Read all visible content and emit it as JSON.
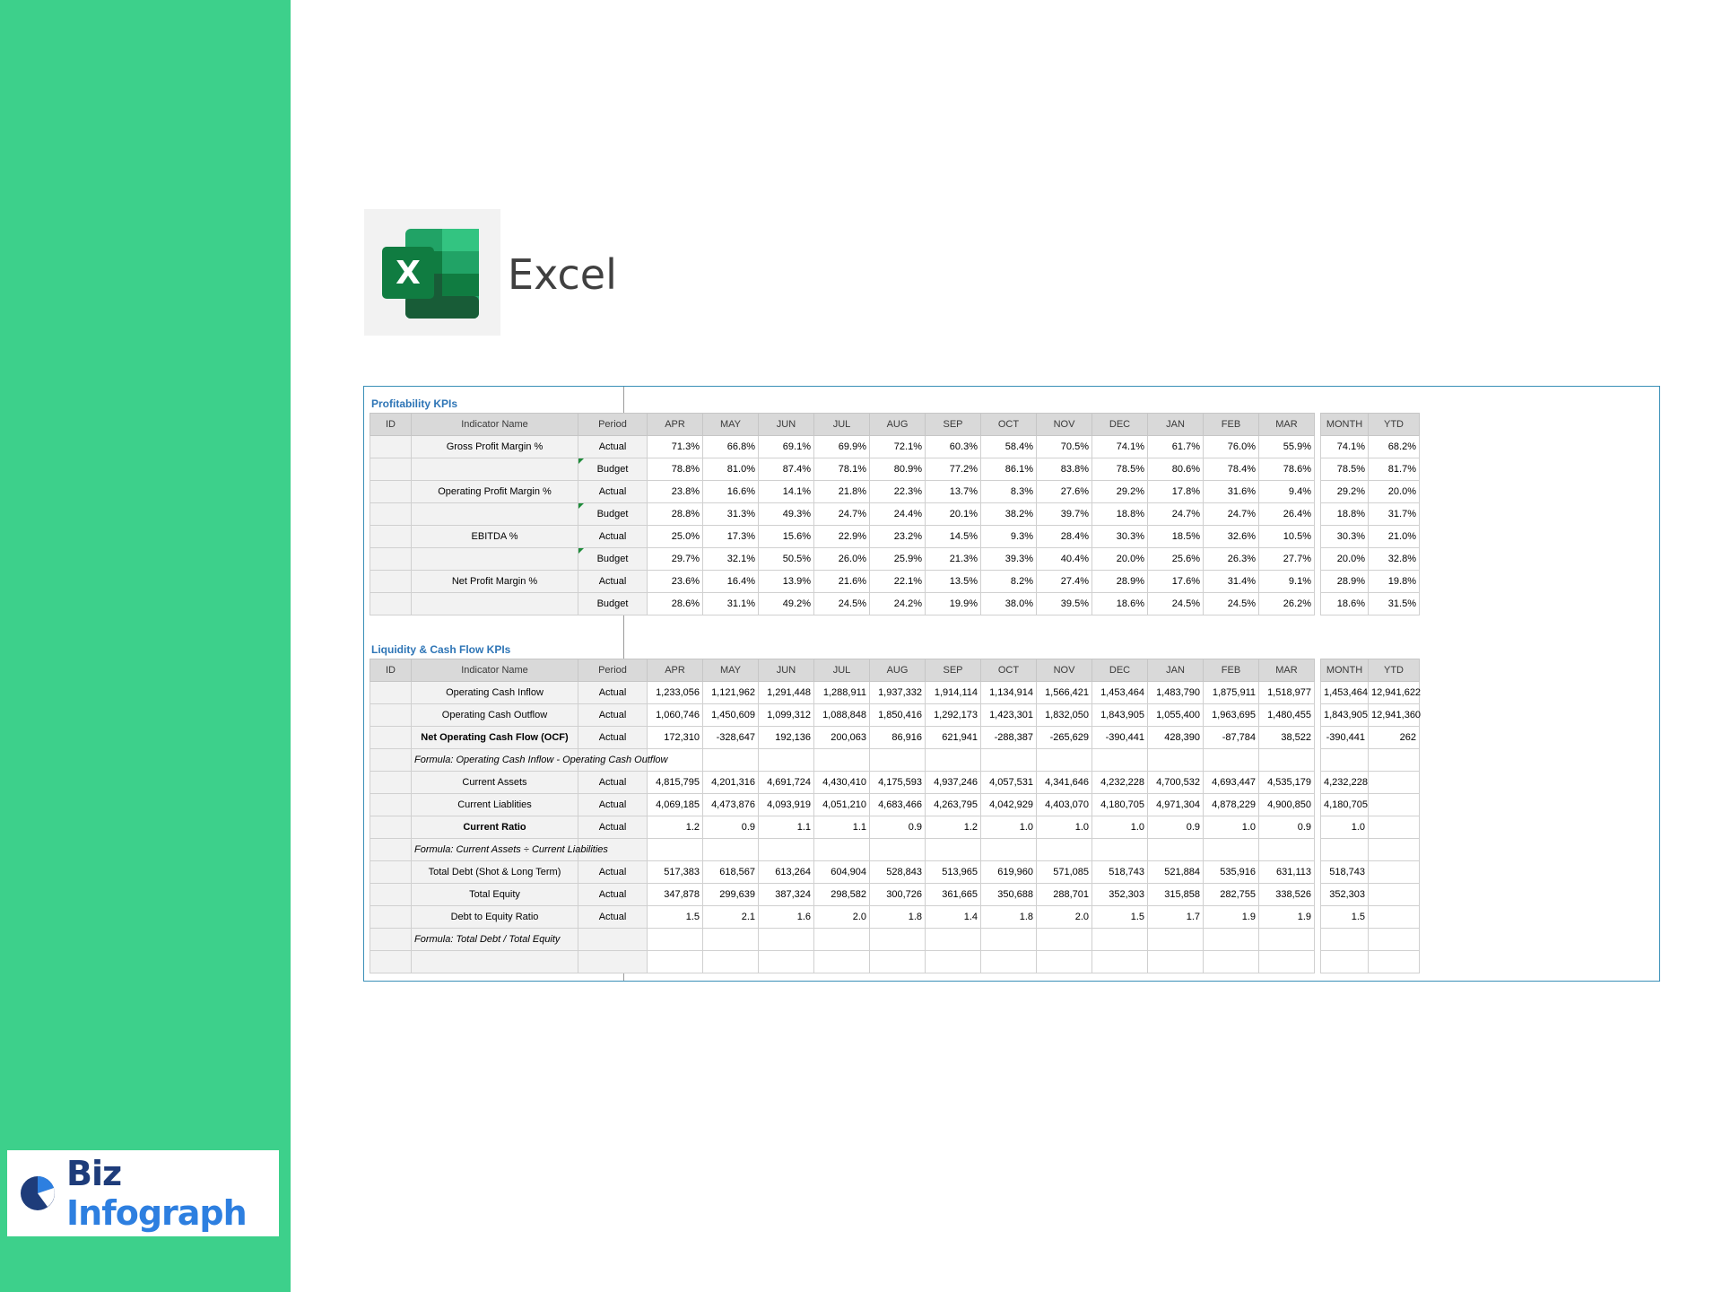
{
  "app": {
    "label": "Excel"
  },
  "brand": {
    "biz": "Biz",
    "infograph": "Infograph"
  },
  "headers": [
    "ID",
    "Indicator Name",
    "Period",
    "APR",
    "MAY",
    "JUN",
    "JUL",
    "AUG",
    "SEP",
    "OCT",
    "NOV",
    "DEC",
    "JAN",
    "FEB",
    "MAR",
    "MONTH",
    "YTD"
  ],
  "colors": {
    "sidebar": "#3dd08b",
    "section_title": "#2e75b6",
    "header_bg": "#d9d9d9",
    "excel_green": "#107c41"
  },
  "profitability": {
    "title": "Profitability KPIs",
    "rows": [
      {
        "name": "Gross Profit Margin %",
        "period": "Actual",
        "values": [
          "71.3%",
          "66.8%",
          "69.1%",
          "69.9%",
          "72.1%",
          "60.3%",
          "58.4%",
          "70.5%",
          "74.1%",
          "61.7%",
          "76.0%",
          "55.9%"
        ],
        "month": "74.1%",
        "ytd": "68.2%"
      },
      {
        "name": "",
        "period": "Budget",
        "marker": true,
        "values": [
          "78.8%",
          "81.0%",
          "87.4%",
          "78.1%",
          "80.9%",
          "77.2%",
          "86.1%",
          "83.8%",
          "78.5%",
          "80.6%",
          "78.4%",
          "78.6%"
        ],
        "month": "78.5%",
        "ytd": "81.7%"
      },
      {
        "name": "Operating Profit Margin %",
        "period": "Actual",
        "values": [
          "23.8%",
          "16.6%",
          "14.1%",
          "21.8%",
          "22.3%",
          "13.7%",
          "8.3%",
          "27.6%",
          "29.2%",
          "17.8%",
          "31.6%",
          "9.4%"
        ],
        "month": "29.2%",
        "ytd": "20.0%"
      },
      {
        "name": "",
        "period": "Budget",
        "marker": true,
        "values": [
          "28.8%",
          "31.3%",
          "49.3%",
          "24.7%",
          "24.4%",
          "20.1%",
          "38.2%",
          "39.7%",
          "18.8%",
          "24.7%",
          "24.7%",
          "26.4%"
        ],
        "month": "18.8%",
        "ytd": "31.7%"
      },
      {
        "name": "EBITDA %",
        "period": "Actual",
        "values": [
          "25.0%",
          "17.3%",
          "15.6%",
          "22.9%",
          "23.2%",
          "14.5%",
          "9.3%",
          "28.4%",
          "30.3%",
          "18.5%",
          "32.6%",
          "10.5%"
        ],
        "month": "30.3%",
        "ytd": "21.0%"
      },
      {
        "name": "",
        "period": "Budget",
        "marker": true,
        "values": [
          "29.7%",
          "32.1%",
          "50.5%",
          "26.0%",
          "25.9%",
          "21.3%",
          "39.3%",
          "40.4%",
          "20.0%",
          "25.6%",
          "26.3%",
          "27.7%"
        ],
        "month": "20.0%",
        "ytd": "32.8%"
      },
      {
        "name": "Net Profit Margin %",
        "period": "Actual",
        "values": [
          "23.6%",
          "16.4%",
          "13.9%",
          "21.6%",
          "22.1%",
          "13.5%",
          "8.2%",
          "27.4%",
          "28.9%",
          "17.6%",
          "31.4%",
          "9.1%"
        ],
        "month": "28.9%",
        "ytd": "19.8%"
      },
      {
        "name": "",
        "period": "Budget",
        "values": [
          "28.6%",
          "31.1%",
          "49.2%",
          "24.5%",
          "24.2%",
          "19.9%",
          "38.0%",
          "39.5%",
          "18.6%",
          "24.5%",
          "24.5%",
          "26.2%"
        ],
        "month": "18.6%",
        "ytd": "31.5%"
      }
    ]
  },
  "liquidity": {
    "title": "Liquidity & Cash Flow KPIs",
    "rows": [
      {
        "name": "Operating Cash Inflow",
        "period": "Actual",
        "values": [
          "1,233,056",
          "1,121,962",
          "1,291,448",
          "1,288,911",
          "1,937,332",
          "1,914,114",
          "1,134,914",
          "1,566,421",
          "1,453,464",
          "1,483,790",
          "1,875,911",
          "1,518,977"
        ],
        "month": "1,453,464",
        "ytd": "12,941,622"
      },
      {
        "name": "Operating Cash Outflow",
        "period": "Actual",
        "values": [
          "1,060,746",
          "1,450,609",
          "1,099,312",
          "1,088,848",
          "1,850,416",
          "1,292,173",
          "1,423,301",
          "1,832,050",
          "1,843,905",
          "1,055,400",
          "1,963,695",
          "1,480,455"
        ],
        "month": "1,843,905",
        "ytd": "12,941,360"
      },
      {
        "name": "Net Operating Cash Flow (OCF)",
        "bold": true,
        "period": "Actual",
        "values": [
          "172,310",
          "-328,647",
          "192,136",
          "200,063",
          "86,916",
          "621,941",
          "-288,387",
          "-265,629",
          "-390,441",
          "428,390",
          "-87,784",
          "38,522"
        ],
        "month": "-390,441",
        "ytd": "262"
      },
      {
        "formula": "Formula: Operating Cash Inflow - Operating Cash Outflow"
      },
      {
        "name": "Current Assets",
        "period": "Actual",
        "values": [
          "4,815,795",
          "4,201,316",
          "4,691,724",
          "4,430,410",
          "4,175,593",
          "4,937,246",
          "4,057,531",
          "4,341,646",
          "4,232,228",
          "4,700,532",
          "4,693,447",
          "4,535,179"
        ],
        "month": "4,232,228",
        "ytd": ""
      },
      {
        "name": "Current Liablities",
        "period": "Actual",
        "values": [
          "4,069,185",
          "4,473,876",
          "4,093,919",
          "4,051,210",
          "4,683,466",
          "4,263,795",
          "4,042,929",
          "4,403,070",
          "4,180,705",
          "4,971,304",
          "4,878,229",
          "4,900,850"
        ],
        "month": "4,180,705",
        "ytd": ""
      },
      {
        "name": "Current Ratio",
        "bold": true,
        "period": "Actual",
        "values": [
          "1.2",
          "0.9",
          "1.1",
          "1.1",
          "0.9",
          "1.2",
          "1.0",
          "1.0",
          "1.0",
          "0.9",
          "1.0",
          "0.9"
        ],
        "month": "1.0",
        "ytd": ""
      },
      {
        "formula": "Formula: Current Assets  ÷ Current Liabilities"
      },
      {
        "name": "Total Debt (Shot & Long Term)",
        "period": "Actual",
        "values": [
          "517,383",
          "618,567",
          "613,264",
          "604,904",
          "528,843",
          "513,965",
          "619,960",
          "571,085",
          "518,743",
          "521,884",
          "535,916",
          "631,113"
        ],
        "month": "518,743",
        "ytd": ""
      },
      {
        "name": "Total Equity",
        "period": "Actual",
        "values": [
          "347,878",
          "299,639",
          "387,324",
          "298,582",
          "300,726",
          "361,665",
          "350,688",
          "288,701",
          "352,303",
          "315,858",
          "282,755",
          "338,526"
        ],
        "month": "352,303",
        "ytd": ""
      },
      {
        "name": "Debt to Equity Ratio",
        "period": "Actual",
        "values": [
          "1.5",
          "2.1",
          "1.6",
          "2.0",
          "1.8",
          "1.4",
          "1.8",
          "2.0",
          "1.5",
          "1.7",
          "1.9",
          "1.9"
        ],
        "month": "1.5",
        "ytd": ""
      },
      {
        "formula": "Formula: Total Debt / Total Equity"
      },
      {
        "empty": true
      }
    ]
  }
}
